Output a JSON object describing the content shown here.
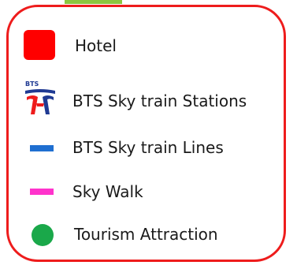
{
  "legend": {
    "items": [
      {
        "label": "Hotel",
        "color": "#ff0000",
        "icon": "hotel-square"
      },
      {
        "label": "BTS Sky train Stations",
        "icon": "bts-logo-icon",
        "icon_text": "BTS"
      },
      {
        "label": "BTS Sky train Lines",
        "color": "#1f6fd1",
        "icon": "line-swatch"
      },
      {
        "label": "Sky Walk",
        "color": "#ff33cc",
        "icon": "line-swatch"
      },
      {
        "label": "Tourism Attraction",
        "color": "#1aa84a",
        "icon": "circle"
      }
    ],
    "border_color": "#ee1c1c",
    "tab_color": "#8cc63f"
  }
}
